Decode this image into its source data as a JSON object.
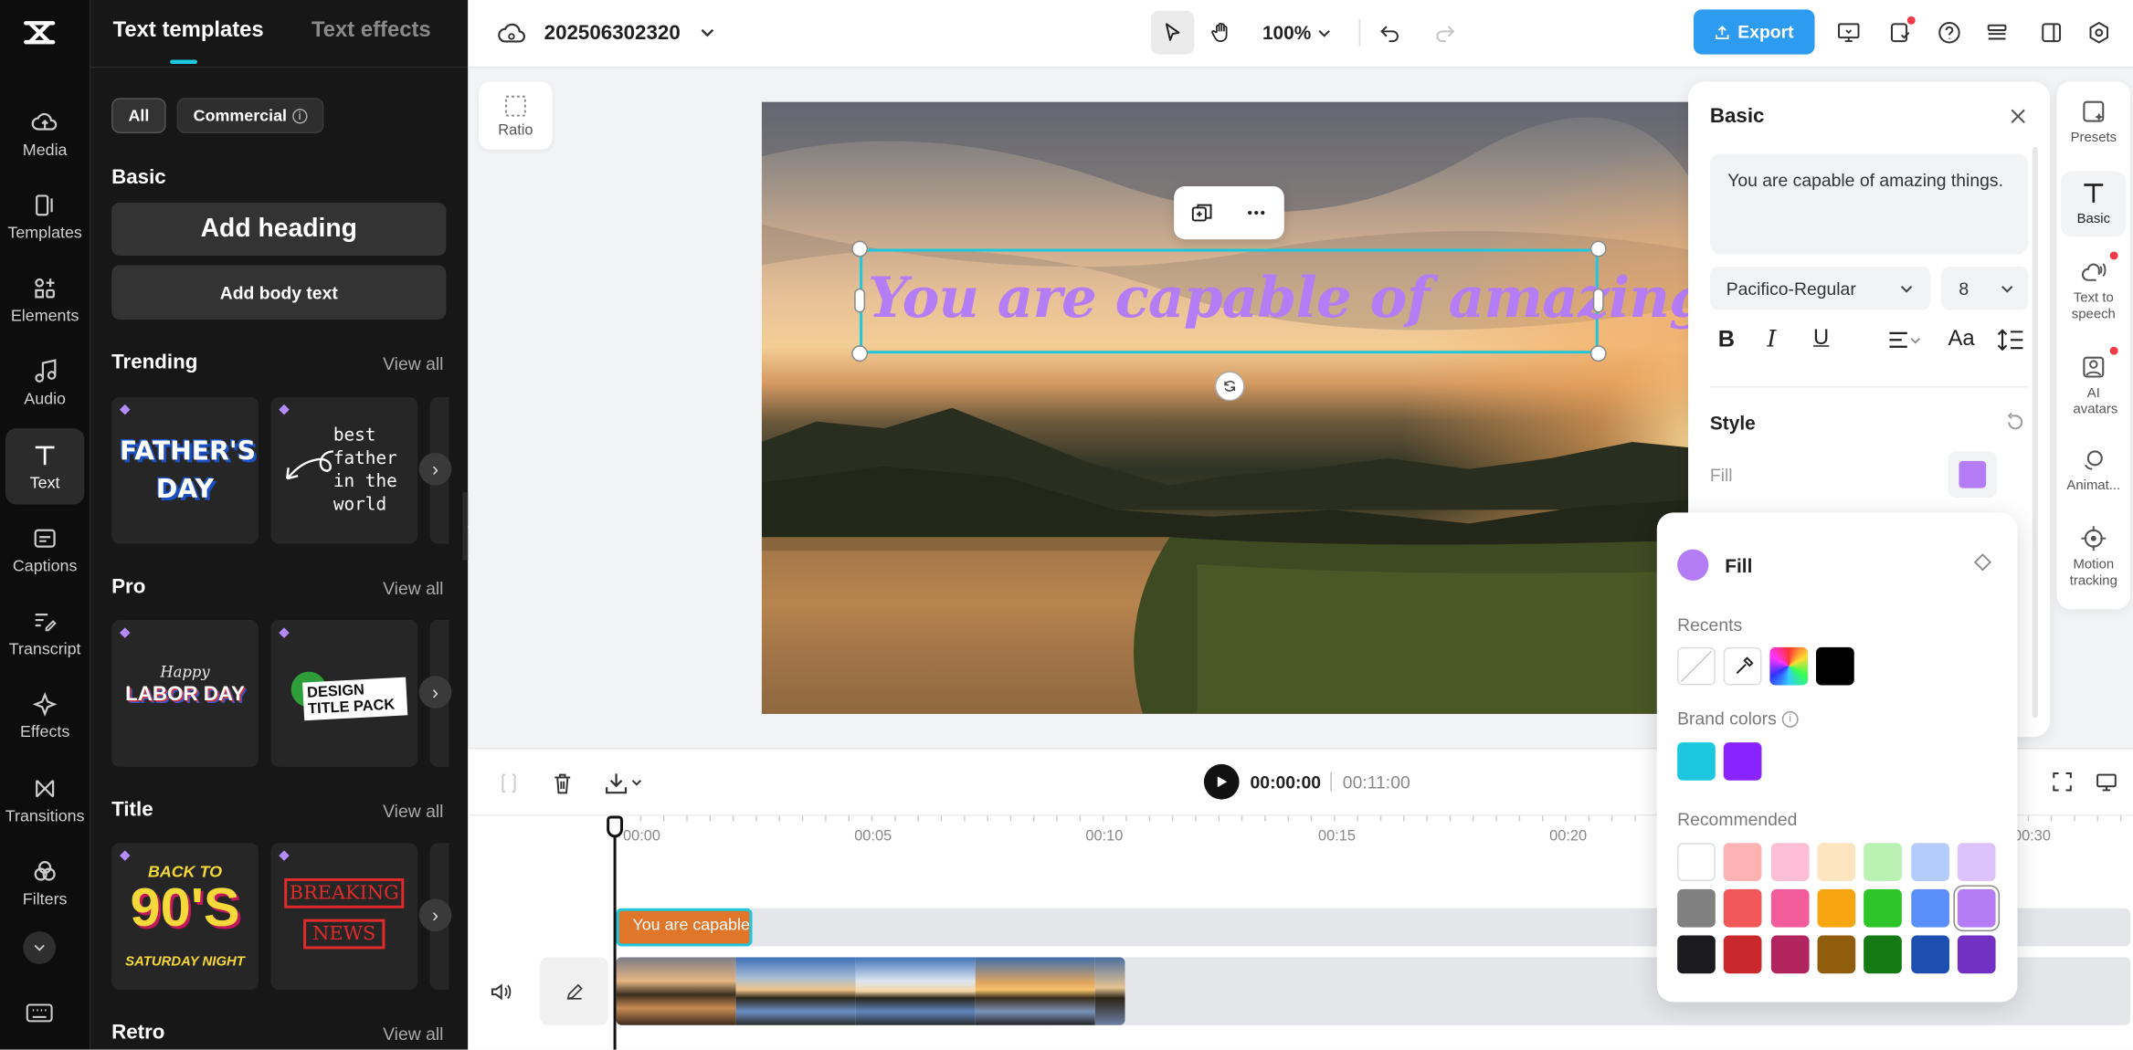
{
  "left_rail": {
    "items": [
      {
        "label": "Media",
        "icon": "cloud-upload-icon"
      },
      {
        "label": "Templates",
        "icon": "templates-icon"
      },
      {
        "label": "Elements",
        "icon": "elements-icon"
      },
      {
        "label": "Audio",
        "icon": "music-note-icon"
      },
      {
        "label": "Text",
        "icon": "text-t-icon"
      },
      {
        "label": "Captions",
        "icon": "captions-icon"
      },
      {
        "label": "Transcript",
        "icon": "transcript-icon"
      },
      {
        "label": "Effects",
        "icon": "sparkle-icon"
      },
      {
        "label": "Transitions",
        "icon": "transitions-icon"
      },
      {
        "label": "Filters",
        "icon": "filters-icon"
      }
    ]
  },
  "panel": {
    "tabs": [
      "Text templates",
      "Text effects"
    ],
    "chips": {
      "all": "All",
      "commercial": "Commercial"
    },
    "basic": {
      "title": "Basic",
      "add_heading": "Add heading",
      "add_body": "Add body text"
    },
    "sections": [
      {
        "title": "Trending",
        "view_all": "View all"
      },
      {
        "title": "Pro",
        "view_all": "View all"
      },
      {
        "title": "Title",
        "view_all": "View all"
      },
      {
        "title": "Retro",
        "view_all": "View all"
      }
    ],
    "card_text": {
      "fathers_day": "FATHER'S DAY",
      "best_father": "best father in the world",
      "labor_happy": "Happy",
      "labor_day": "LABOR DAY",
      "design_pack": "DESIGN TITLE PACK",
      "back_to": "BACK TO",
      "nineties": "90'S",
      "saturday": "SATURDAY NIGHT",
      "breaking": "BREAKING",
      "news": "NEWS"
    }
  },
  "topbar": {
    "project_name": "202506302320",
    "zoom": "100%",
    "export_label": "Export"
  },
  "canvas": {
    "ratio_label": "Ratio",
    "overlay_text": "You are capable of amazing things.",
    "text_color": "#b47cf5"
  },
  "inspector": {
    "title": "Basic",
    "text_value": "You are capable of amazing things.",
    "font": "Pacifico-Regular",
    "font_size": "8",
    "style_label": "Style",
    "fill_label": "Fill",
    "fill_color": "#b47cf5"
  },
  "right_rail": [
    {
      "label": "Presets",
      "icon": "presets-icon"
    },
    {
      "label": "Basic",
      "icon": "text-t-icon"
    },
    {
      "label": "Text to speech",
      "icon": "speech-icon"
    },
    {
      "label": "AI avatars",
      "icon": "avatar-icon"
    },
    {
      "label": "Animat...",
      "icon": "animation-icon"
    },
    {
      "label": "Motion tracking",
      "icon": "motion-tracking-icon"
    }
  ],
  "popover": {
    "title": "Fill",
    "current_color": "#b47cf5",
    "recents_label": "Recents",
    "recents": [
      "none",
      "eyedropper",
      "gradient",
      "#000000"
    ],
    "brand_label": "Brand colors",
    "brand": [
      "#1dc8de",
      "#8a24ff"
    ],
    "recommended_label": "Recommended",
    "recommended": [
      [
        "#ffffff",
        "#fdb3b3",
        "#fdbed6",
        "#fde5bf",
        "#b9f2b3",
        "#b3ccfb",
        "#dcc3fb"
      ],
      [
        "#808080",
        "#f2585a",
        "#f25c9b",
        "#f7a611",
        "#2ec52a",
        "#5b8ff9",
        "#b47cf5"
      ],
      [
        "#1a1a1f",
        "#c9292d",
        "#b2245e",
        "#8f5d0b",
        "#157a14",
        "#1d4fb0",
        "#7331c4"
      ]
    ]
  },
  "timeline": {
    "current_time": "00:00:00",
    "duration": "00:11:00",
    "ticks": [
      "00:00",
      "00:05",
      "00:10",
      "00:15",
      "00:20",
      "00:30"
    ],
    "text_clip": "You are capable"
  }
}
